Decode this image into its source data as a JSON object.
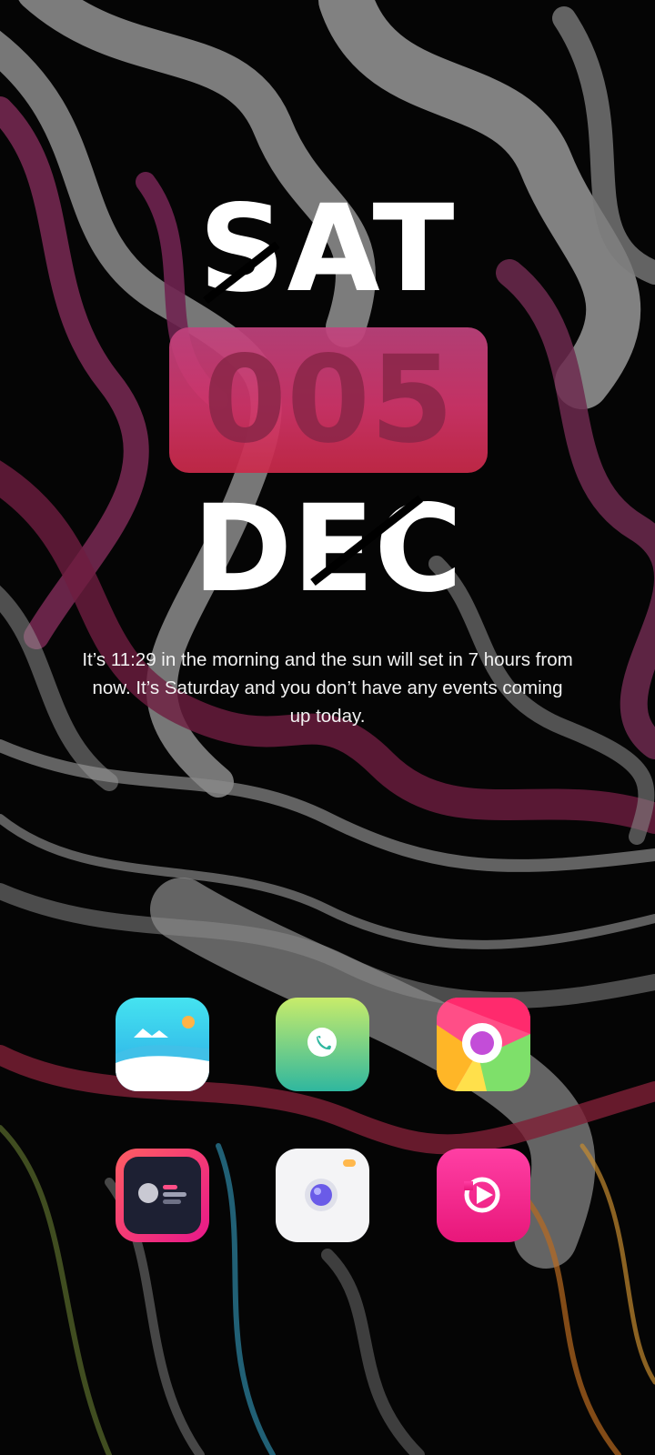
{
  "clock_widget": {
    "day": "SAT",
    "date": "005",
    "month": "DEC"
  },
  "summary_text": "It’s 11:29 in the morning and the sun will set in 7 hours from now. It’s Saturday and you don’t have any events coming up today.",
  "dock_apps": [
    {
      "icon": "gallery-icon"
    },
    {
      "icon": "phone-icon"
    },
    {
      "icon": "browser-icon"
    },
    {
      "icon": "contacts-icon"
    },
    {
      "icon": "camera-icon"
    },
    {
      "icon": "video-player-icon"
    }
  ],
  "colors": {
    "accent": "#c9356c",
    "background": "#000000"
  }
}
